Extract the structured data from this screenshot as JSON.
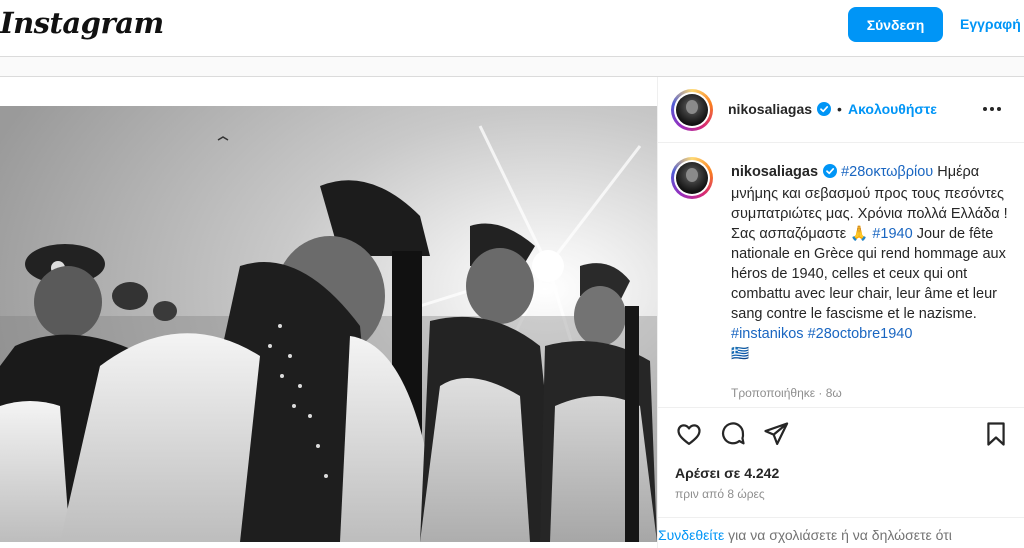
{
  "header": {
    "logo": "Instagram",
    "login_label": "Σύνδεση",
    "signup_label": "Εγγραφή"
  },
  "post": {
    "username": "nikosaliagas",
    "follow_label": "Ακολουθήστε",
    "dot": "•",
    "caption": {
      "hashtag_top": "#28οκτωβρίου",
      "line1": "Ημέρα μνήμης και σεβασμού προς τους πεσόντες συμπατριώτες μας. Χρόνια πολλά Ελλάδα ! Σας ασπαζόμαστε 🙏",
      "hashtag_1940": "#1940",
      "line2": "Jour de fête nationale en Grèce qui rend hommage aux héros de 1940, celles et ceux qui ont combattu avec leur chair, leur âme et leur sang contre le fascisme et le nazisme.",
      "hashtag_instanikos": "#instanikos",
      "hashtag_28octobre": "#28octobre1940",
      "flag_emoji": "🇬🇷"
    },
    "edited": "Τροποποιήθηκε · 8ω",
    "likes": "Αρέσει σε 4.242",
    "time_ago": "πριν από 8 ώρες",
    "comment_prompt_link": "Συνδεθείτε",
    "comment_prompt_rest": " για να σχολιάσετε ή να δηλώσετε ότι"
  },
  "colors": {
    "accent": "#0095f6",
    "verified": "#0095f6",
    "hashtag": "#1a66c1",
    "muted": "#8e8e8e"
  },
  "icons": [
    "verified-badge-icon",
    "more-options-icon",
    "heart-icon",
    "comment-icon",
    "share-icon",
    "bookmark-icon"
  ]
}
